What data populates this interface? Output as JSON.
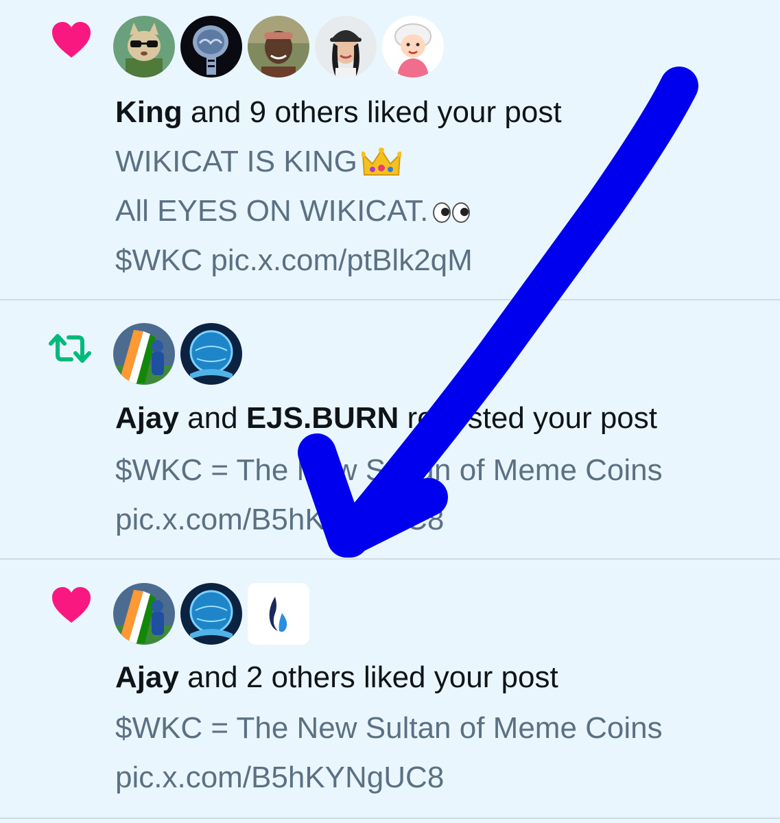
{
  "colors": {
    "background": "#eaf6fd",
    "like_heart": "#f91880",
    "repost": "#00ba7c",
    "headline_text": "#0f1419",
    "secondary_text": "#5b7083",
    "divider": "#cfdce5",
    "annotation_arrow": "#0000ee"
  },
  "notifications": [
    {
      "type": "like",
      "icon": "heart-icon",
      "avatars": [
        "cat-with-sunglasses-avatar",
        "skull-xray-avatar",
        "woman-headband-avatar",
        "woman-cap-avatar",
        "grandma-cartoon-avatar"
      ],
      "actor": "King",
      "action": " and 9 others liked your post",
      "lines": [
        "WIKICAT IS KING",
        "All EYES ON WIKICAT.",
        "$WKC pic.x.com/ptBlk2qM"
      ],
      "emojis": [
        "crown-emoji",
        "eyes-emoji"
      ]
    },
    {
      "type": "repost",
      "icon": "repost-icon",
      "avatars": [
        "cricket-flag-avatar",
        "blue-globe-avatar"
      ],
      "actor": "Ajay",
      "connector": " and ",
      "actor2": "EJS.BURN",
      "action": " reposted your post",
      "lines": [
        "$WKC = The New Sultan of Meme Coins",
        "pic.x.com/B5hKYNgUC8"
      ]
    },
    {
      "type": "like",
      "icon": "heart-icon",
      "avatars": [
        "cricket-flag-avatar",
        "blue-globe-avatar",
        "blue-flame-logo-avatar"
      ],
      "actor": "Ajay",
      "action": " and 2 others liked your post",
      "lines": [
        "$WKC = The New Sultan of Meme Coins",
        "pic.x.com/B5hKYNgUC8"
      ]
    }
  ]
}
